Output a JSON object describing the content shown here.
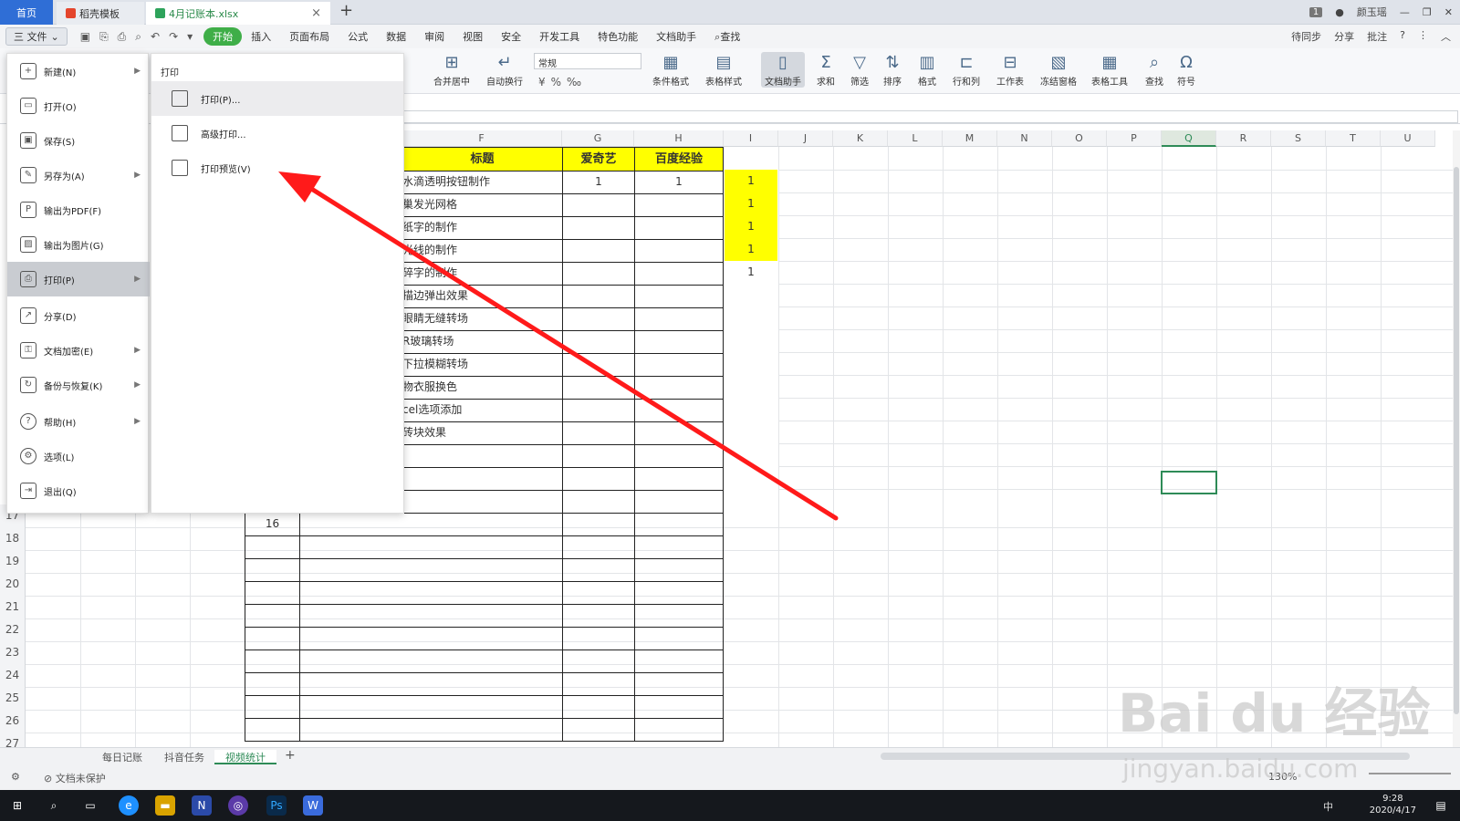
{
  "tabs": {
    "home": "首页",
    "template": "稻壳模板",
    "file": "4月记账本.xlsx",
    "new": "+"
  },
  "titlebar": {
    "badge": "1",
    "user": "颜玉瑶"
  },
  "menubar": {
    "file": "三 文件",
    "items": [
      "开始",
      "插入",
      "页面布局",
      "公式",
      "数据",
      "审阅",
      "视图",
      "安全",
      "开发工具",
      "特色功能",
      "文档助手",
      "查找"
    ],
    "right": [
      "待同步",
      "分享",
      "批注"
    ]
  },
  "ribbon": {
    "merge": "合并居中",
    "wrap": "自动换行",
    "format": "常规",
    "cond": "条件格式",
    "tblstyle": "表格样式",
    "doc": "文档助手",
    "sum": "求和",
    "filter": "筛选",
    "sort": "排序",
    "fmt": "格式",
    "rowcol": "行和列",
    "sheet": "工作表",
    "freeze": "冻结窗格",
    "tbltool": "表格工具",
    "find": "查找",
    "symbol": "符号"
  },
  "columns": [
    "F",
    "G",
    "H",
    "I",
    "J",
    "K",
    "L",
    "M",
    "N",
    "O",
    "P",
    "Q",
    "R",
    "S",
    "T",
    "U"
  ],
  "rows": [
    "17",
    "18",
    "19",
    "20",
    "21",
    "22",
    "23",
    "24",
    "25",
    "26",
    "27"
  ],
  "table": {
    "headers": [
      "标题",
      "爱奇艺",
      "百度经验"
    ],
    "titles": [
      "水滴透明按钮制作",
      "巢发光网格",
      "纸字的制作",
      "光线的制作",
      "碎字的制作",
      "描边弹出效果",
      "眼睛无缝转场",
      "R玻璃转场",
      "下拉模糊转场",
      "物衣服换色",
      "cel选项添加",
      "砖块效果"
    ],
    "g_row1": "1",
    "h_row1": "1",
    "i_values": [
      "1",
      "1",
      "1",
      "1",
      "1"
    ],
    "row17_num": "16"
  },
  "file_menu": {
    "items": [
      "新建(N)",
      "打开(O)",
      "保存(S)",
      "另存为(A)",
      "输出为PDF(F)",
      "输出为图片(G)",
      "打印(P)",
      "分享(D)",
      "文档加密(E)",
      "备份与恢复(K)",
      "帮助(H)",
      "选项(L)",
      "退出(Q)"
    ]
  },
  "print_submenu": {
    "title": "打印",
    "items": [
      "打印(P)...",
      "高级打印...",
      "打印预览(V)"
    ]
  },
  "sheets": [
    "每日记账",
    "抖音任务",
    "视频统计",
    "+"
  ],
  "status": {
    "protect": "文档未保护",
    "zoom": "130%"
  },
  "taskbar": {
    "time": "9:28",
    "date": "2020/4/17",
    "ime": "中"
  },
  "watermark": {
    "main": "Bai du 经验",
    "url": "jingyan.baidu.com"
  }
}
